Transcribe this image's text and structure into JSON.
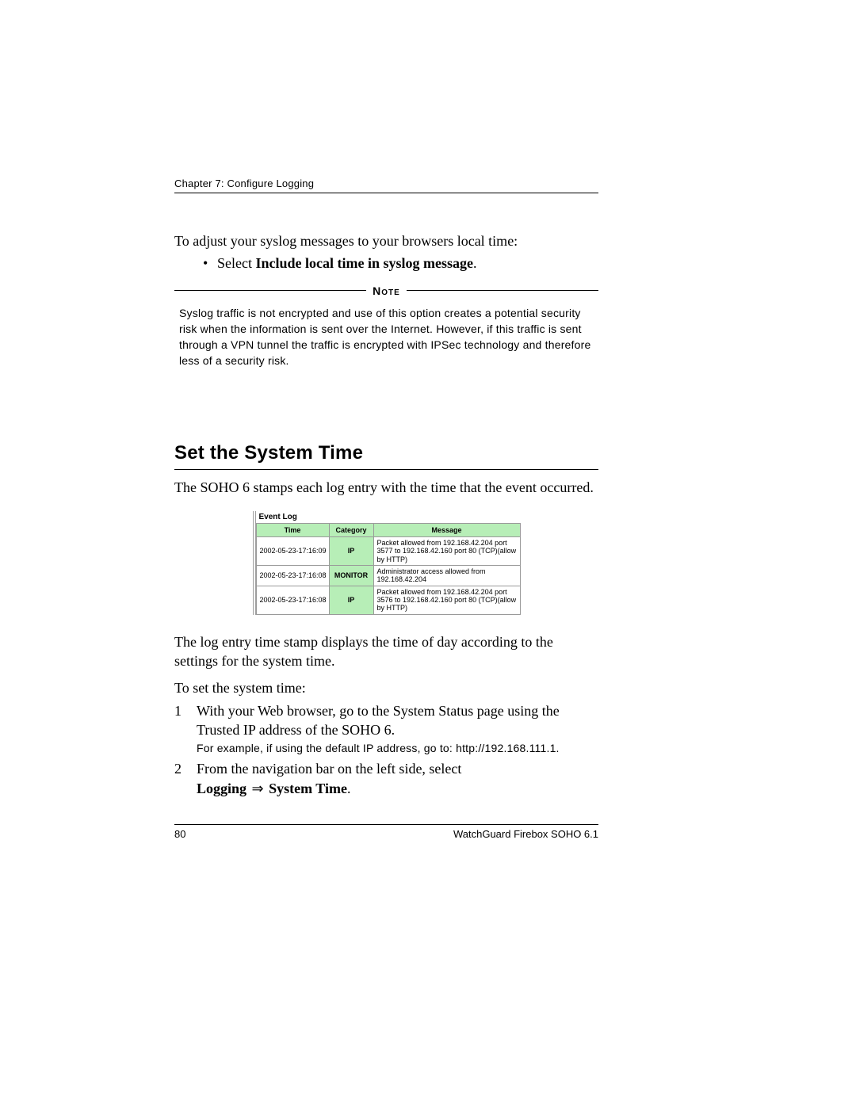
{
  "chapter_header": "Chapter 7: Configure Logging",
  "intro_line": "To adjust your syslog messages to your browsers local time:",
  "bullet_prefix": "Select ",
  "bullet_bold": "Include local time in syslog message",
  "bullet_suffix": ".",
  "note_label": "Note",
  "note_body": "Syslog traffic is not encrypted and use of this option creates a potential security risk when the information is sent over the Internet. However, if this traffic is sent through a VPN tunnel the traffic is encrypted with IPSec technology and therefore less of a security risk.",
  "section_heading": "Set the System Time",
  "section_intro": "The SOHO 6 stamps each log entry with the time that the event occurred.",
  "event_log": {
    "title": "Event Log",
    "headers": {
      "time": "Time",
      "category": "Category",
      "message": "Message"
    },
    "rows": [
      {
        "time": "2002-05-23-17:16:09",
        "category": "IP",
        "message": "Packet allowed from 192.168.42.204 port 3577 to 192.168.42.160 port 80 (TCP)(allow by HTTP)"
      },
      {
        "time": "2002-05-23-17:16:08",
        "category": "MONITOR",
        "message": "Administrator access allowed from 192.168.42.204"
      },
      {
        "time": "2002-05-23-17:16:08",
        "category": "IP",
        "message": "Packet allowed from 192.168.42.204 port 3576 to 192.168.42.160 port 80 (TCP)(allow by HTTP)"
      }
    ]
  },
  "after_table": "The log entry time stamp displays the time of day according to the settings for the system time.",
  "steps_intro": "To set the system time:",
  "steps": [
    {
      "num": "1",
      "text": "With your Web browser, go to the System Status page using the Trusted IP address of the SOHO 6.",
      "sub": "For example, if using the default IP address, go to: http://192.168.111.1."
    },
    {
      "num": "2",
      "text_pre": "From the navigation bar on the left side, select",
      "nav_a": "Logging",
      "arrow": "⇒",
      "nav_b": "System Time",
      "suffix": "."
    }
  ],
  "footer": {
    "page": "80",
    "product": "WatchGuard Firebox SOHO 6.1"
  }
}
